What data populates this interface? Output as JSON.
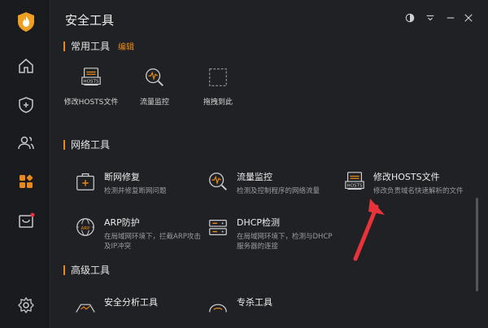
{
  "window": {
    "title": "安全工具"
  },
  "sidebar": {
    "items": [
      {
        "icon": "home-icon"
      },
      {
        "icon": "shield-plus-icon"
      },
      {
        "icon": "users-icon"
      },
      {
        "icon": "apps-icon",
        "active": true
      },
      {
        "icon": "store-icon",
        "badge": true
      },
      {
        "icon": "settings-icon"
      }
    ]
  },
  "common_tools": {
    "title": "常用工具",
    "edit_label": "编辑",
    "items": [
      {
        "label": "修改HOSTS文件",
        "icon": "hosts-file-icon"
      },
      {
        "label": "流量监控",
        "icon": "traffic-monitor-icon"
      },
      {
        "label": "拖拽到此",
        "icon": "drop-zone-icon"
      }
    ]
  },
  "network_tools": {
    "title": "网络工具",
    "items": [
      {
        "name": "断网修复",
        "desc": "检测并修复断网问题",
        "icon": "network-repair-icon"
      },
      {
        "name": "流量监控",
        "desc": "检测及控制程序的网络流量",
        "icon": "traffic-monitor-icon"
      },
      {
        "name": "修改HOSTS文件",
        "desc": "修改负责域名快速解析的文件",
        "icon": "hosts-file-icon"
      },
      {
        "name": "ARP防护",
        "desc": "在局域网环境下，拦截ARP攻击及IP冲突",
        "icon": "arp-globe-icon"
      },
      {
        "name": "DHCP检测",
        "desc": "在局域网环境下，检测与DHCP服务器的连接",
        "icon": "dhcp-server-icon"
      }
    ]
  },
  "advanced_tools": {
    "title": "高级工具",
    "items": [
      {
        "name": "安全分析工具",
        "icon": "security-analysis-icon"
      },
      {
        "name": "专杀工具",
        "icon": "removal-tool-icon"
      }
    ]
  },
  "colors": {
    "accent": "#e8891c",
    "annotation_arrow": "#e8333a"
  }
}
